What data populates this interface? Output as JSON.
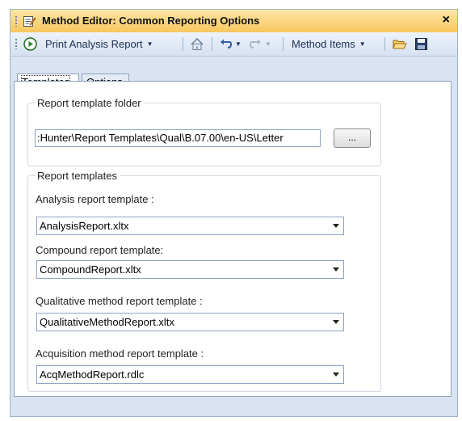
{
  "window": {
    "title": "Method Editor: Common Reporting Options",
    "close_glyph": "×"
  },
  "toolbar": {
    "run_icon": "play-circle-icon",
    "print_label": "Print Analysis Report",
    "home_icon": "home-icon",
    "undo_icon": "undo-icon",
    "redo_icon": "redo-icon",
    "method_items_label": "Method Items",
    "open_icon": "open-folder-icon",
    "save_icon": "save-icon"
  },
  "tabs": [
    {
      "label": "Templates"
    },
    {
      "label": "Options"
    }
  ],
  "folder_group": {
    "title": "Report template folder",
    "path": ":Hunter\\Report Templates\\Qual\\B.07.00\\en-US\\Letter",
    "browse_label": "..."
  },
  "templates_group": {
    "title": "Report templates",
    "items": [
      {
        "label": "Analysis report template :",
        "value": "AnalysisReport.xltx"
      },
      {
        "label": "Compound report template:",
        "value": "CompoundReport.xltx"
      },
      {
        "label": "Qualitative method report template :",
        "value": "QualitativeMethodReport.xltx"
      },
      {
        "label": "Acquisition method report template :",
        "value": "AcqMethodReport.rdlc"
      }
    ]
  },
  "colors": {
    "title_bar": "#f7c65f",
    "frame": "#d9e3f1",
    "run_green": "#2e8b2e"
  }
}
